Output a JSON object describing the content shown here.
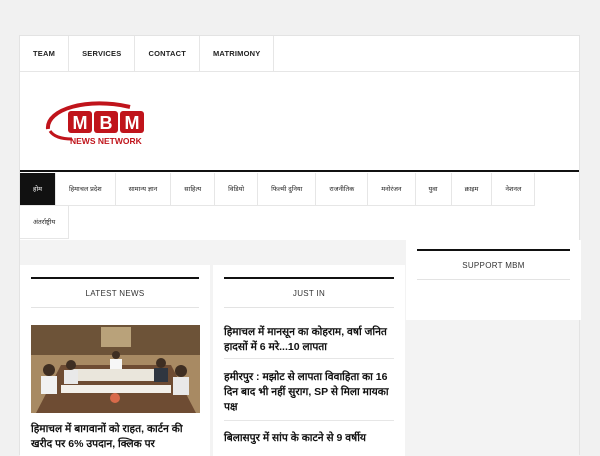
{
  "topnav": [
    "TEAM",
    "SERVICES",
    "CONTACT",
    "MATRIMONY"
  ],
  "logo": {
    "letters": "MBM",
    "tagline": "NEWS NETWORK",
    "brand_red": "#c0141b"
  },
  "mainnav": {
    "row1": [
      "होम",
      "हिमाचल प्रदेश",
      "सामान्य ज्ञान",
      "साहित्य",
      "विडियो",
      "फिल्मी दुनिया",
      "राजनीतिक",
      "मनोरंजन",
      "युवा",
      "क्राइम",
      "नेशनल"
    ],
    "row2": [
      "अंतर्राष्ट्रीय"
    ]
  },
  "latest": {
    "title": "LATEST NEWS",
    "headline": "हिमाचल में बागवानों को राहत, कार्टन की खरीद पर 6% उपदान, क्लिक पर"
  },
  "justin": {
    "title": "JUST IN",
    "items": [
      "हिमाचल में मानसून का कोहराम, वर्षा जनित हादसों में 6 मरे...10 लापता",
      "हमीरपुर : मझोट से लापता विवाहिता का 16 दिन बाद भी नहीं सुराग, SP से मिला मायका पक्ष",
      "बिलासपुर में सांप के काटने से 9 वर्षीय"
    ]
  },
  "support": {
    "title": "SUPPORT MBM"
  }
}
